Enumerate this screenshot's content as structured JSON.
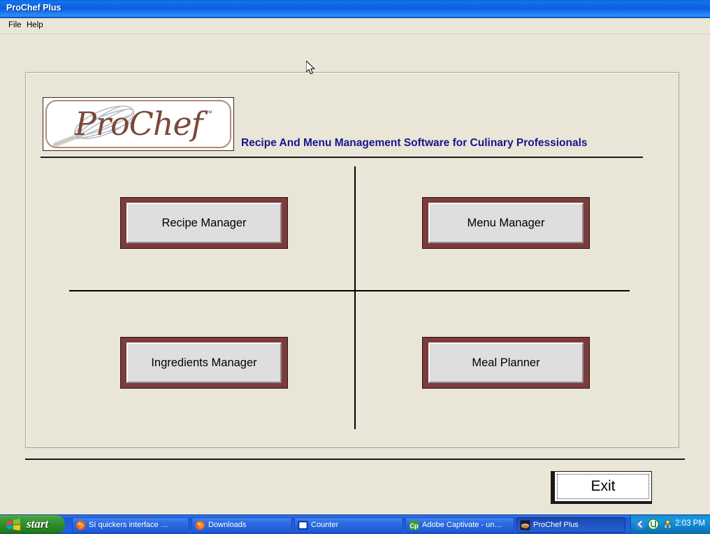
{
  "window": {
    "title": "ProChef Plus",
    "menu": [
      {
        "label": "File"
      },
      {
        "label": "Help"
      }
    ]
  },
  "branding": {
    "logo_text": "ProChef",
    "logo_trademark": "™",
    "tagline": "Recipe And Menu Management Software for Culinary Professionals",
    "logo_color": "#7a4a38",
    "tagline_color": "#16168c"
  },
  "nav_buttons": [
    {
      "label": "Recipe Manager"
    },
    {
      "label": "Menu Manager"
    },
    {
      "label": "Ingredients Manager"
    },
    {
      "label": "Meal Planner"
    }
  ],
  "actions": {
    "exit_label": "Exit"
  },
  "colors": {
    "window_background": "#eae6d7",
    "button_frame": "#7d3b3b",
    "button_face": "#dedede",
    "titlebar_blue": "#0a5ee0"
  },
  "taskbar": {
    "start_label": "start",
    "tasks": [
      {
        "label": "SI quickers interface …",
        "icon": "firefox-icon",
        "active": false
      },
      {
        "label": "Downloads",
        "icon": "firefox-icon",
        "active": false
      },
      {
        "label": "Counter",
        "icon": "window-icon",
        "active": false
      },
      {
        "label": "Adobe Captivate - un…",
        "icon": "captivate-icon",
        "active": false
      },
      {
        "label": "ProChef Plus",
        "icon": "prochef-icon",
        "active": true
      }
    ],
    "tray": {
      "clock": "2:03 PM",
      "icons": [
        "show-hidden-icons-chevron",
        "utorrent-icon",
        "tray-misc-icon"
      ]
    }
  }
}
